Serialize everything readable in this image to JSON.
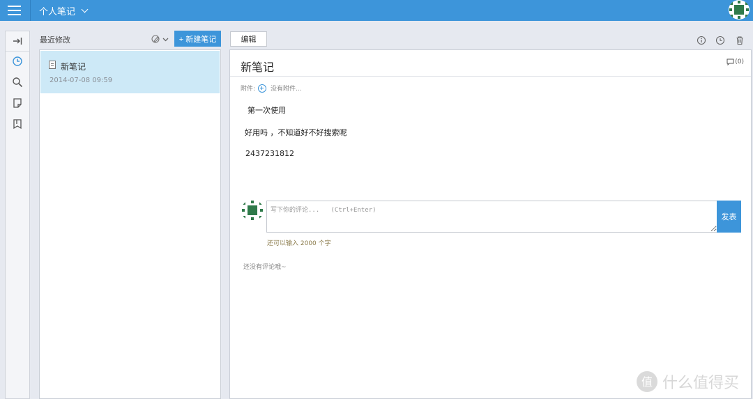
{
  "header": {
    "notebook_title": "个人笔记",
    "bg_color": "#3d95da"
  },
  "rail": {
    "icons": [
      "expand-icon",
      "clock-icon",
      "search-icon",
      "note-icon",
      "bookmark-icon"
    ]
  },
  "list": {
    "heading": "最近修改",
    "new_note_label": "+ 新建笔记",
    "items": [
      {
        "title": "新笔记",
        "date": "2014-07-08 09:59"
      }
    ]
  },
  "editor": {
    "edit_label": "编辑",
    "title": "新笔记",
    "comment_count": "(0)",
    "attachments_label": "附件:",
    "no_attachments": "没有附件...",
    "body_lines": [
      "第一次使用",
      "好用吗 ，不知道好不好搜索呢",
      "2437231812"
    ]
  },
  "comments": {
    "placeholder": "写下你的评论...   (Ctrl+Enter)",
    "post_label": "发表",
    "char_limit": "还可以输入 2000 个字",
    "empty_text": "还没有评论哦~"
  },
  "watermark": {
    "text": "什么值得买",
    "logo_glyph": "值"
  }
}
